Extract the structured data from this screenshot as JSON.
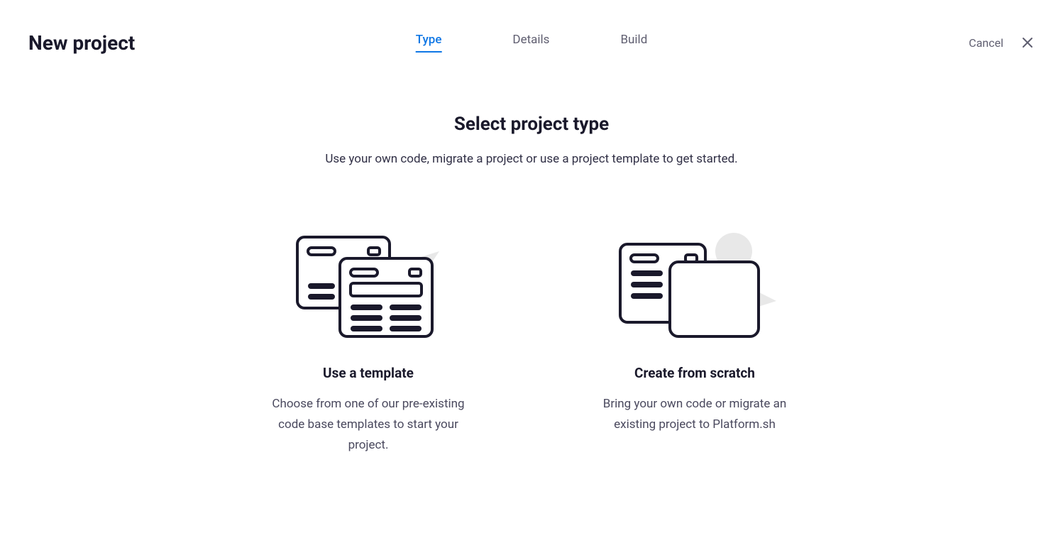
{
  "header": {
    "title": "New project",
    "cancel": "Cancel"
  },
  "tabs": [
    {
      "label": "Type",
      "active": true
    },
    {
      "label": "Details",
      "active": false
    },
    {
      "label": "Build",
      "active": false
    }
  ],
  "main": {
    "title": "Select project type",
    "subtitle": "Use your own code, migrate a project or use a project template to get started."
  },
  "options": [
    {
      "title": "Use a template",
      "description": "Choose from one of our pre-existing code base templates to start your project."
    },
    {
      "title": "Create from scratch",
      "description": "Bring your own code or migrate an existing project to Platform.sh"
    }
  ]
}
